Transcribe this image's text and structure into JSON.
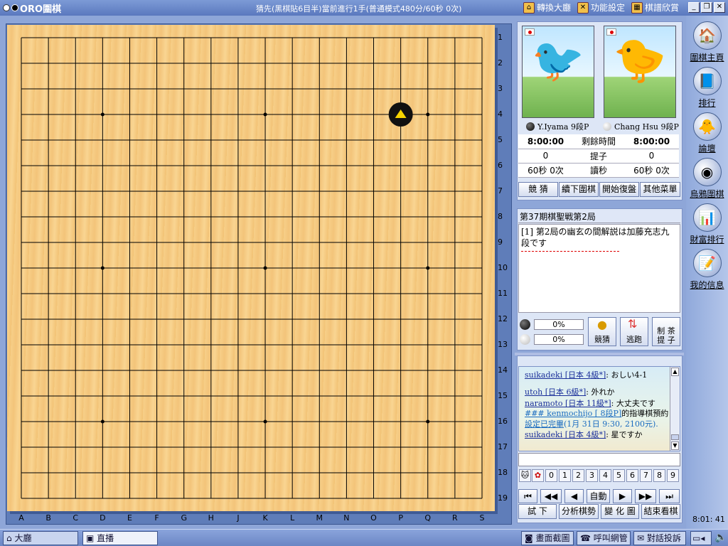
{
  "app": {
    "title": "ORO圍棋",
    "status": "猜先(黑棋貼6目半)當前進行1手(普通模式480分/60秒 0次)",
    "menu": [
      "轉換大廳",
      "功能設定",
      "棋譜欣賞"
    ]
  },
  "board": {
    "rows": [
      "1",
      "2",
      "3",
      "4",
      "5",
      "6",
      "7",
      "8",
      "9",
      "10",
      "11",
      "12",
      "13",
      "14",
      "15",
      "16",
      "17",
      "18",
      "19"
    ],
    "cols": [
      "A",
      "B",
      "C",
      "D",
      "E",
      "F",
      "G",
      "H",
      "J",
      "K",
      "L",
      "M",
      "N",
      "O",
      "P",
      "Q",
      "R",
      "S"
    ],
    "last_move": {
      "col": "P",
      "row": "4",
      "color": "black"
    }
  },
  "players": {
    "black": {
      "name": "Y.Iyama 9段P"
    },
    "white": {
      "name": "Chang Hsu 9段P"
    }
  },
  "clock": {
    "black_time": "8:00:00",
    "white_time": "8:00:00",
    "time_label": "剩餘時間",
    "black_captures": "0",
    "white_captures": "0",
    "captures_label": "提子",
    "black_byo": "60秒 0次",
    "white_byo": "60秒 0次",
    "byo_label": "讀秒"
  },
  "actions": [
    "競 猜",
    "續下圍棋",
    "開始復盤",
    "其他菜單"
  ],
  "commentary": {
    "title": "第37期棋聖戦第2局",
    "text": "[1] 第2局の幽玄の間解説は加藤充志九段です"
  },
  "predict": {
    "black_pct": "0%",
    "white_pct": "0%",
    "buttons": [
      "競猜",
      "逃跑",
      "制 茶\n提 子"
    ]
  },
  "chat": [
    {
      "user": "suikadeki [日本 4級*]",
      "msg": ": おしい4-1"
    },
    {
      "user": "utoh [日本 6級*]",
      "msg": ": 外れか"
    },
    {
      "user": "naramoto [日本 11級*]",
      "msg": ": 大丈夫です"
    },
    {
      "user": "### kenmochijo [ 8段P]",
      "msg": "的指導棋預約"
    },
    {
      "user": "設定已完畢",
      "msg": "(1月 31日 9:30, 2100元)."
    },
    {
      "user": "suikadeki [日本 4級*]",
      "msg": ": 星ですか"
    }
  ],
  "numbers": [
    "0",
    "1",
    "2",
    "3",
    "4",
    "5",
    "6",
    "7",
    "8",
    "9"
  ],
  "nav_controls": {
    "auto": "自動"
  },
  "bottom_buttons": [
    "試  下",
    "分析棋勢",
    "變 化 圖",
    "結束看棋"
  ],
  "clock_display": "8:01: 41",
  "right_nav": [
    "圍棋主頁",
    "排行",
    "論壇",
    "烏鴉圍棋",
    "財富排行",
    "我的信息"
  ],
  "taskbar": {
    "left": [
      "大廳",
      "直播"
    ],
    "right": [
      "畫面截圖",
      "呼叫網管",
      "對話投訴"
    ]
  },
  "colors": {
    "board": "#f5c97f",
    "frame": "#5f7db9",
    "titlebar": "#6f8dcb"
  }
}
